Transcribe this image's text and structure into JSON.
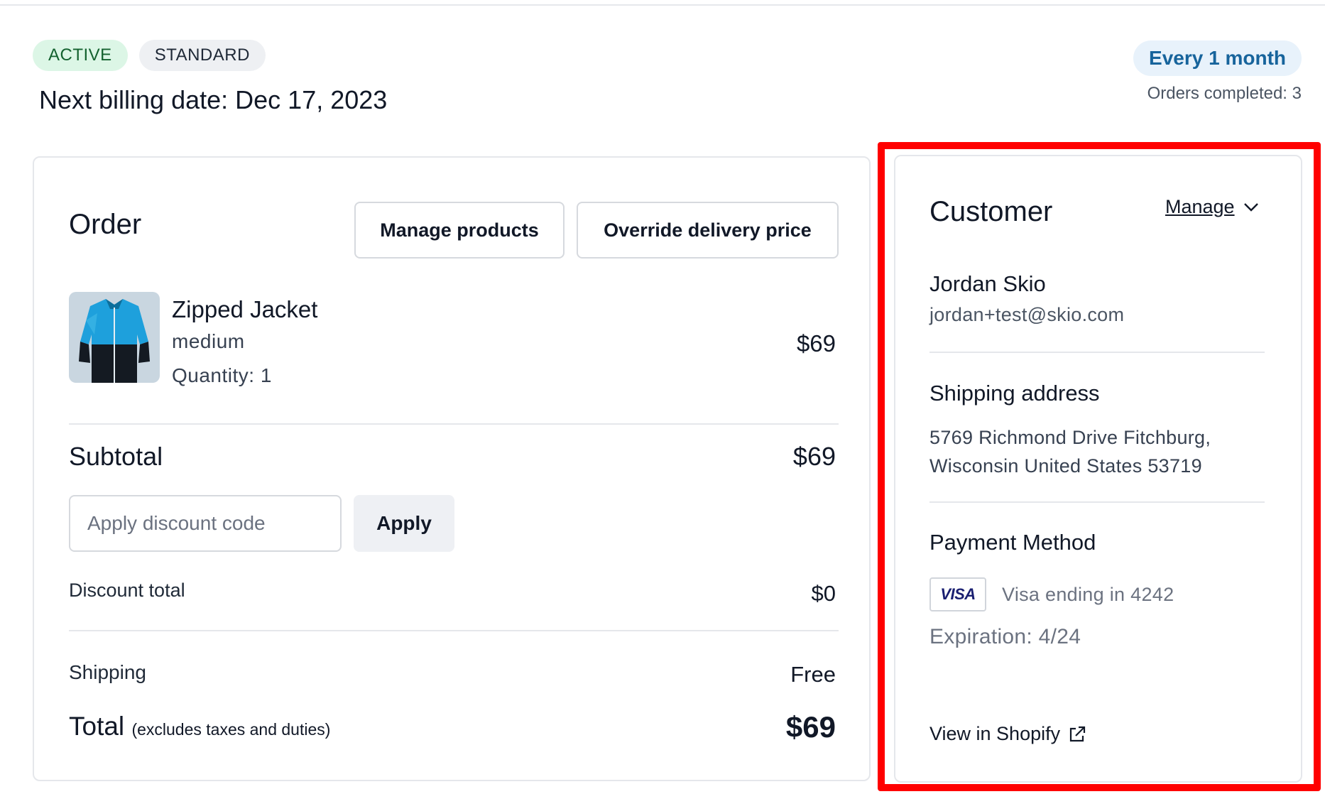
{
  "subscription": {
    "status_badge": "ACTIVE",
    "plan_badge": "STANDARD",
    "next_billing": "Next billing date: Dec 17, 2023",
    "frequency": "Every 1 month",
    "orders_completed": "Orders completed: 3"
  },
  "order": {
    "title": "Order",
    "manage_products_label": "Manage products",
    "override_delivery_label": "Override delivery price",
    "product": {
      "name": "Zipped Jacket",
      "variant": "medium",
      "quantity": "Quantity: 1",
      "price": "$69",
      "image_icon": "jacket-thumbnail"
    },
    "subtotal_label": "Subtotal",
    "subtotal_value": "$69",
    "discount_placeholder": "Apply discount code",
    "apply_label": "Apply",
    "discount_total_label": "Discount total",
    "discount_total_value": "$0",
    "shipping_label": "Shipping",
    "shipping_value": "Free",
    "total_label": "Total",
    "total_note": "(excludes taxes and duties)",
    "total_value": "$69"
  },
  "customer": {
    "title": "Customer",
    "manage_label": "Manage",
    "name": "Jordan Skio",
    "email": "jordan+test@skio.com",
    "shipping_title": "Shipping address",
    "shipping_address": "5769 Richmond Drive Fitchburg, Wisconsin United States 53719",
    "payment_title": "Payment Method",
    "card_brand": "VISA",
    "card_text": "Visa ending in 4242",
    "expiration": "Expiration: 4/24",
    "view_shopify_label": "View in Shopify"
  },
  "colors": {
    "active_badge_bg": "#dcf6e6",
    "active_badge_text": "#14622f",
    "frequency_bg": "#e8f2fb",
    "frequency_text": "#17649c",
    "highlight": "#ff0000"
  }
}
